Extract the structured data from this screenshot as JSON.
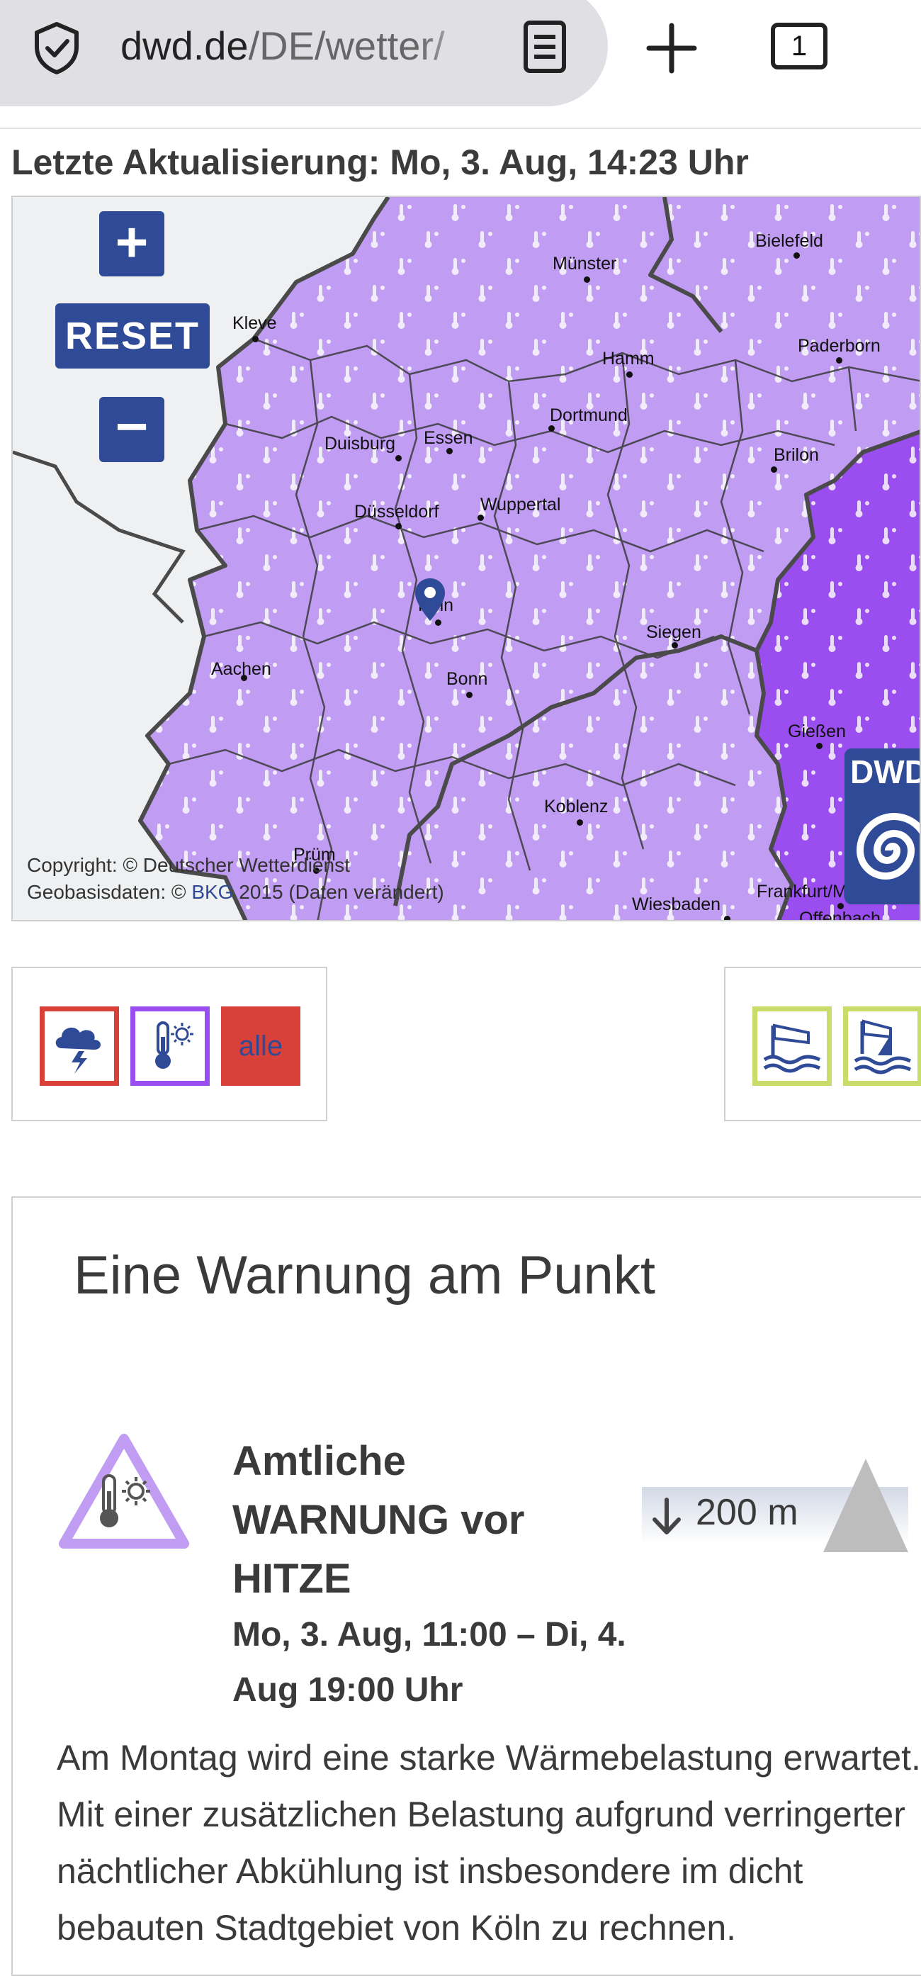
{
  "browser": {
    "url": "dwd.de/DE/wetter/",
    "url_domain": "dwd.de",
    "url_path": "/DE/wetter/",
    "tab_count": "1",
    "icons": [
      "shield-icon",
      "reader-mode-icon",
      "new-tab-plus-icon",
      "tab-count-icon"
    ]
  },
  "header": {
    "last_update": "Letzte Aktualisierung: Mo, 3. Aug, 14:23 Uhr"
  },
  "map": {
    "zoom_in": "+",
    "reset": "RESET",
    "zoom_out": "−",
    "cities": [
      "Münster",
      "Bielefeld",
      "Kleve",
      "Hamm",
      "Paderborn",
      "Dortmund",
      "Duisburg",
      "Essen",
      "Brilon",
      "Wuppertal",
      "Düsseldorf",
      "Köln",
      "Siegen",
      "Aachen",
      "Bonn",
      "Gießen",
      "Koblenz",
      "Prüm",
      "Frankfurt/M",
      "Wiesbaden",
      "Offenbach"
    ],
    "copyright_line1": "Copyright: © Deutscher Wetterdienst",
    "copyright_line2_prefix": "Geobasisdaten: © ",
    "copyright_link": "BKG",
    "copyright_line2_suffix": " 2015 (Daten verändert)",
    "logo_text": "DWD",
    "colors": {
      "warning_light": "#c09cf2",
      "warning_dark": "#9a4ef0",
      "land_outside": "#eef0f2",
      "accent": "#2f4a96"
    }
  },
  "filters": {
    "group1": [
      {
        "icon": "thunderstorm-icon",
        "border": "#d8403a"
      },
      {
        "icon": "heat-icon",
        "border": "#9a4ef0"
      },
      {
        "label": "alle"
      }
    ],
    "group2": [
      {
        "icon": "coastal-wind-icon",
        "border": "#c8dc6a"
      },
      {
        "icon": "sailing-wind-icon",
        "border": "#c8dc6a"
      }
    ]
  },
  "warning": {
    "heading": "Eine Warnung am Punkt",
    "title": "Amtliche WARNUNG vor HITZE",
    "time": "Mo, 3. Aug, 11:00 – Di, 4. Aug 19:00 Uhr",
    "altitude": "200 m",
    "description": "Am Montag wird eine starke Wärmebelastung erwartet. Mit einer zusätzlichen Belastung aufgrund verringerter nächtlicher Abkühlung ist insbesondere im dicht bebauten Stadtgebiet von Köln zu rechnen."
  }
}
